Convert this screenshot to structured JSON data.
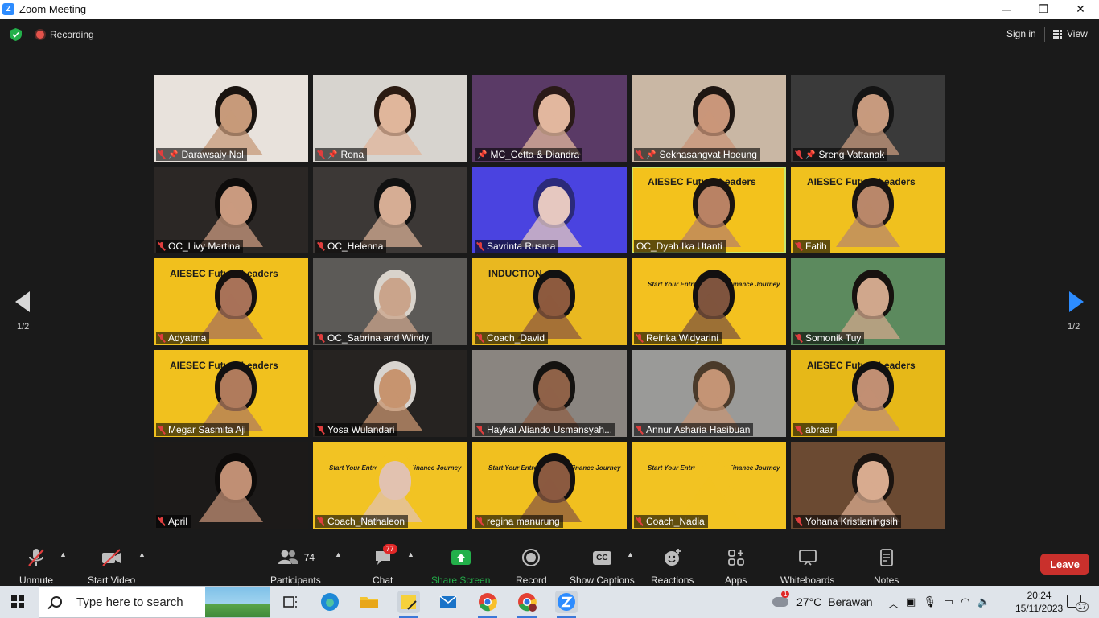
{
  "window": {
    "title": "Zoom Meeting",
    "minimize": "─",
    "maximize": "❐",
    "close": "✕"
  },
  "topbar": {
    "recording": "Recording",
    "signin": "Sign in",
    "view": "View"
  },
  "pagination": {
    "left": "1/2",
    "right": "1/2"
  },
  "participants_grid": [
    {
      "name": "Darawsaiy Nol",
      "muted": true,
      "pinned": true,
      "bg": "#e8e2dc",
      "face": "#c79a7a",
      "hair": "#1a1410"
    },
    {
      "name": "Rona",
      "muted": true,
      "pinned": true,
      "bg": "#d7d4cf",
      "face": "#e0b69b",
      "hair": "#2b1b12"
    },
    {
      "name": "MC_Cetta & Diandra",
      "muted": false,
      "pinned": true,
      "bg": "#5a3a66",
      "face": "#e2b79e",
      "hair": "#2a1a18"
    },
    {
      "name": "Sekhasangvat Hoeung",
      "muted": true,
      "pinned": true,
      "bg": "#c9b7a4",
      "face": "#c9967a",
      "hair": "#1e1612"
    },
    {
      "name": "Sreng Vattanak",
      "muted": true,
      "pinned": true,
      "bg": "#3a3a3a",
      "face": "#c79a7e",
      "hair": "#141414"
    },
    {
      "name": "OC_Livy Martina",
      "muted": true,
      "pinned": false,
      "bg": "#2b2725",
      "face": "#c99a7f",
      "hair": "#0e0c0b"
    },
    {
      "name": "OC_Helenna",
      "muted": true,
      "pinned": false,
      "bg": "#3c3836",
      "face": "#d6ad94",
      "hair": "#111111"
    },
    {
      "name": "Savrinta Rusma",
      "muted": true,
      "pinned": false,
      "bg": "#4a43e0",
      "face": "#e6c8c0",
      "hair": "#2b2a7a"
    },
    {
      "name": "OC_Dyah Ika Utanti",
      "muted": false,
      "pinned": false,
      "bg": "#f3c21c",
      "face": "#b98264",
      "hair": "#1a1410",
      "poster": "AIESEC Future Leaders",
      "active": true
    },
    {
      "name": "Fatih",
      "muted": true,
      "pinned": false,
      "bg": "#f0c11e",
      "face": "#b9876a",
      "hair": "#181412",
      "poster": "AIESEC Future Leaders"
    },
    {
      "name": "Adyatma",
      "muted": true,
      "pinned": false,
      "bg": "#f1c01d",
      "face": "#a87258",
      "hair": "#15110f",
      "poster": "AIESEC Future Leaders"
    },
    {
      "name": "OC_Sabrina and Windy",
      "muted": true,
      "pinned": false,
      "bg": "#5c5a57",
      "face": "#caa48b",
      "hair": "#d9d3cb"
    },
    {
      "name": "Coach_David",
      "muted": true,
      "pinned": false,
      "bg": "#e9b820",
      "face": "#8d5a3e",
      "hair": "#111111",
      "poster": "INDUCTION"
    },
    {
      "name": "Reinka Widyarini",
      "muted": true,
      "pinned": false,
      "bg": "#f3c11f",
      "face": "#7f543e",
      "hair": "#131010",
      "poster": "Start Your Entrepreneur & Finance Journey"
    },
    {
      "name": "Somonik Tuy",
      "muted": true,
      "pinned": false,
      "bg": "#5c8a5e",
      "face": "#d0a78c",
      "hair": "#17120f"
    },
    {
      "name": "Megar Sasmita Aji",
      "muted": true,
      "pinned": false,
      "bg": "#f1c11e",
      "face": "#b07b5c",
      "hair": "#121010",
      "poster": "AIESEC Future Leaders"
    },
    {
      "name": "Yosa Wulandari",
      "muted": true,
      "pinned": false,
      "bg": "#262321",
      "face": "#c7946f",
      "hair": "#d8d4cf"
    },
    {
      "name": "Haykal Aliando Usmansyah...",
      "muted": true,
      "pinned": false,
      "bg": "#8a8580",
      "face": "#8f6248",
      "hair": "#141210"
    },
    {
      "name": "Annur Asharia Hasibuan",
      "muted": true,
      "pinned": false,
      "bg": "#9a9a98",
      "face": "#c49475",
      "hair": "#4a3a2a"
    },
    {
      "name": "abraar",
      "muted": true,
      "pinned": false,
      "bg": "#e6b818",
      "face": "#c18f73",
      "hair": "#111111",
      "poster": "AIESEC Future Leaders"
    },
    {
      "name": "April",
      "muted": true,
      "pinned": false,
      "bg": "#1c1a19",
      "face": "#c08f74",
      "hair": "#0d0b0a"
    },
    {
      "name": "Coach_Nathaleon",
      "muted": true,
      "pinned": false,
      "bg": "#f2c323",
      "face": "#e2c2b0",
      "hair": "#f2c323",
      "poster": "Start Your Entrepreneur & Finance Journey"
    },
    {
      "name": "regina manurung",
      "muted": true,
      "pinned": false,
      "bg": "#f1c01f",
      "face": "#8b5a40",
      "hair": "#121010",
      "poster": "Start Your Entrepreneur & Finance Journey"
    },
    {
      "name": "Coach_Nadia",
      "muted": true,
      "pinned": false,
      "bg": "#f2c322",
      "face": "#f2c322",
      "hair": "#f2c322",
      "poster": "Start Your Entrepreneur & Finance Journey"
    },
    {
      "name": "Yohana Kristianingsih",
      "muted": true,
      "pinned": false,
      "bg": "#6b4a32",
      "face": "#d8ab8f",
      "hair": "#1b1410"
    }
  ],
  "toolbar": {
    "unmute": "Unmute",
    "start_video": "Start Video",
    "participants": "Participants",
    "participants_count": "74",
    "chat": "Chat",
    "chat_badge": "77",
    "share_screen": "Share Screen",
    "record": "Record",
    "show_captions": "Show Captions",
    "captions_icon": "CC",
    "reactions": "Reactions",
    "apps": "Apps",
    "whiteboards": "Whiteboards",
    "notes": "Notes",
    "leave": "Leave"
  },
  "taskbar": {
    "search_placeholder": "Type here to search",
    "weather_temp": "27°C",
    "weather_text": "Berawan",
    "weather_badge": "1",
    "time": "20:24",
    "date": "15/11/2023",
    "notifications": "17"
  },
  "colors": {
    "zoom_blue": "#2d8cff",
    "leave_red": "#c9302c",
    "share_green": "#23b04a",
    "mute_red": "#e03e3e"
  }
}
